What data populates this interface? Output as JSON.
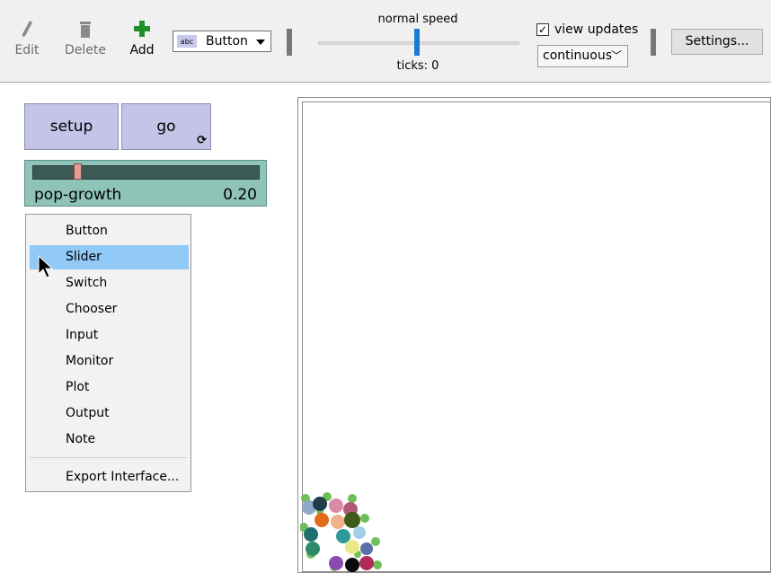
{
  "toolbar": {
    "edit": {
      "label": "Edit",
      "icon": "pencil-icon"
    },
    "delete": {
      "label": "Delete",
      "icon": "trash-icon"
    },
    "add": {
      "label": "Add",
      "icon": "plus-icon",
      "color": "#1f8f2a"
    },
    "widget_type": {
      "badge": "abc",
      "selected": "Button"
    },
    "speed_label": "normal speed",
    "speed_fraction": 0.5,
    "ticks_label": "ticks: 0",
    "view_updates": {
      "label": "view updates",
      "checked": true
    },
    "update_mode": "continuous",
    "settings_label": "Settings..."
  },
  "interface": {
    "setup_label": "setup",
    "go_label": "go",
    "go_forever_icon": "forever-icon",
    "slider": {
      "name": "pop-growth",
      "value": "0.20",
      "fraction": 0.2
    },
    "button_color": "#c4c4e9",
    "slider_color": "#8fc3b8"
  },
  "context_menu": {
    "items": [
      "Button",
      "Slider",
      "Switch",
      "Chooser",
      "Input",
      "Monitor",
      "Plot",
      "Output",
      "Note"
    ],
    "highlighted": "Slider",
    "footer": "Export Interface...",
    "highlight_color": "#91c9f7"
  }
}
